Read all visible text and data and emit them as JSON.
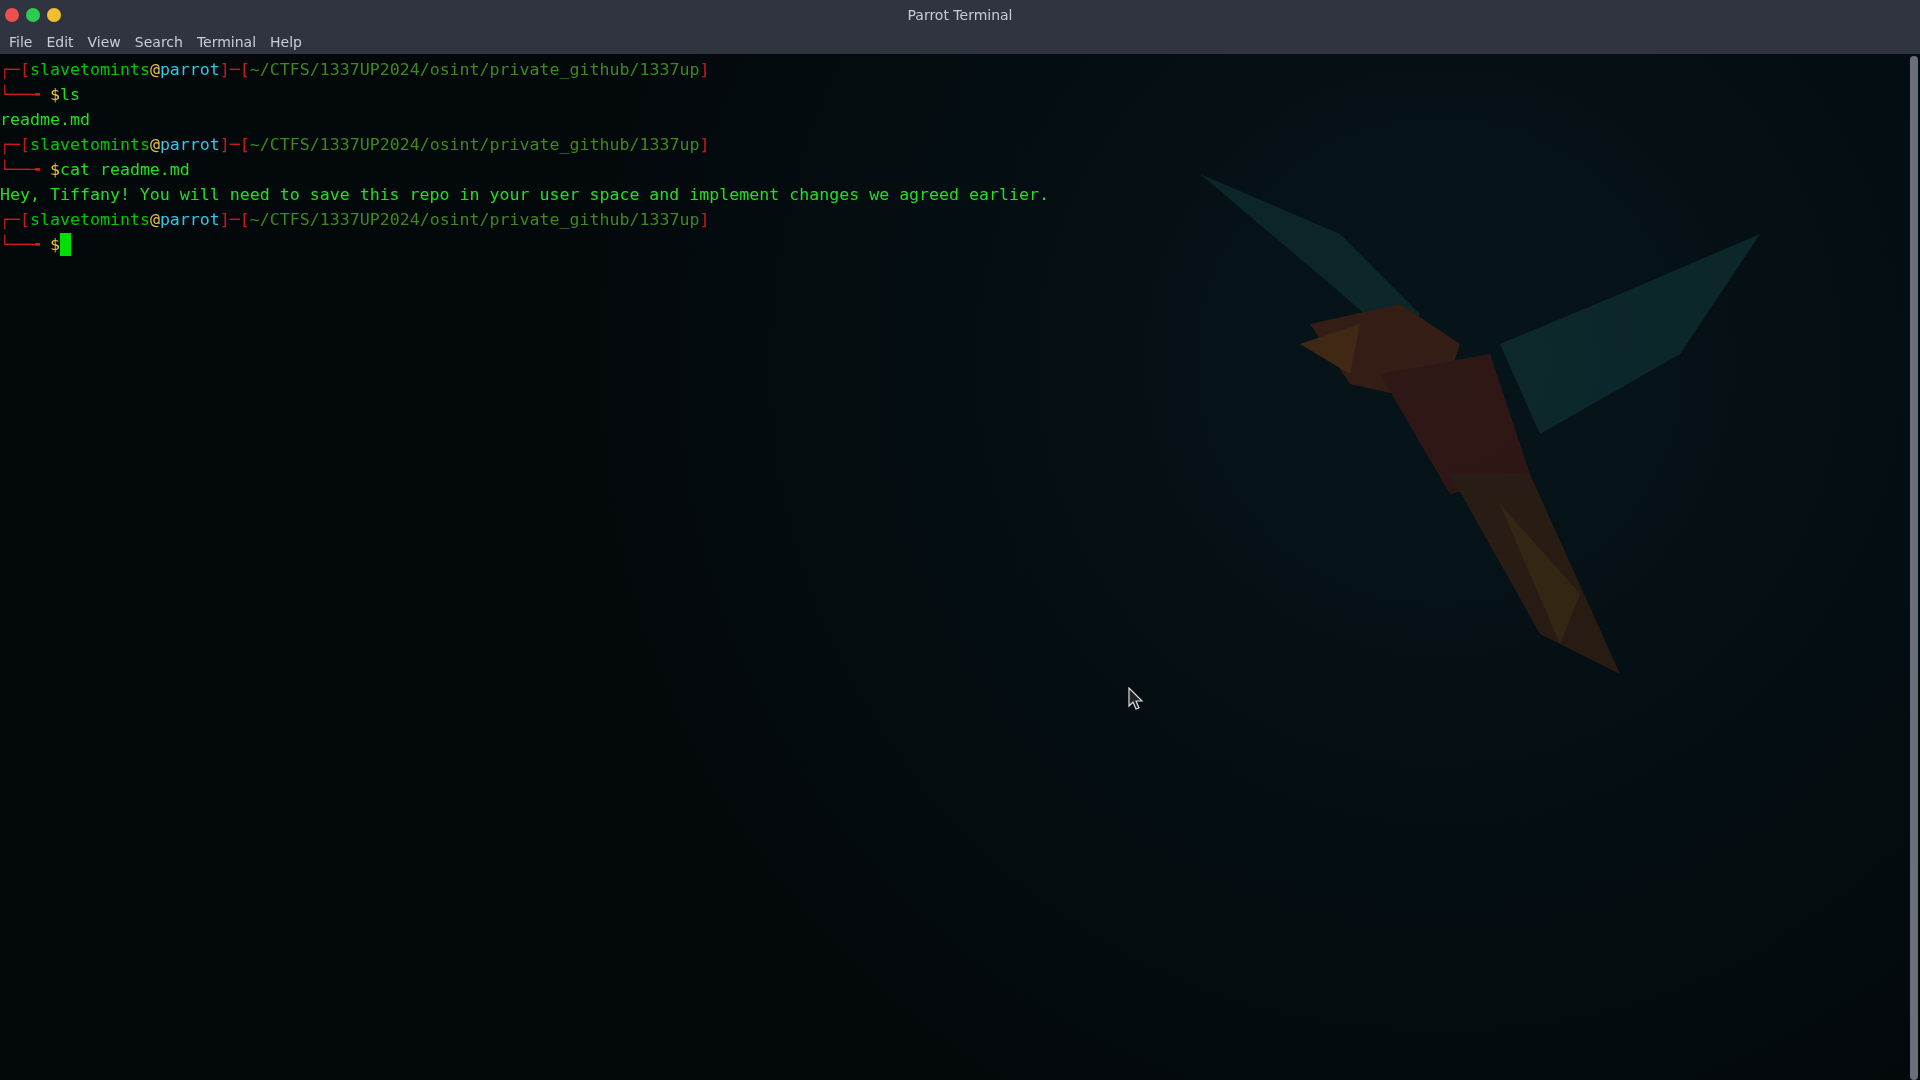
{
  "window": {
    "title": "Parrot Terminal",
    "controls": [
      {
        "color": "#ed4f4f"
      },
      {
        "color": "#2fcb4e"
      },
      {
        "color": "#f3bf30"
      }
    ]
  },
  "menu": [
    "File",
    "Edit",
    "View",
    "Search",
    "Terminal",
    "Help"
  ],
  "terminal": {
    "lines": [
      {
        "kind": "prompt",
        "top_open": "┌─[",
        "user": "slavetomints",
        "at": "@",
        "host": "parrot",
        "separator": "]─[",
        "path": "~/CTFS/1337UP2024/osint/private_github/1337up",
        "top_close": "]",
        "bottom": "└──╼ ",
        "sigil": "$",
        "command": "ls",
        "cursor": false
      },
      {
        "kind": "output",
        "text": "readme.md"
      },
      {
        "kind": "prompt",
        "top_open": "┌─[",
        "user": "slavetomints",
        "at": "@",
        "host": "parrot",
        "separator": "]─[",
        "path": "~/CTFS/1337UP2024/osint/private_github/1337up",
        "top_close": "]",
        "bottom": "└──╼ ",
        "sigil": "$",
        "command": "cat readme.md",
        "cursor": false
      },
      {
        "kind": "output",
        "text": "Hey, Tiffany! You will need to save this repo in your user space and implement changes we agreed earlier."
      },
      {
        "kind": "prompt",
        "top_open": "┌─[",
        "user": "slavetomints",
        "at": "@",
        "host": "parrot",
        "separator": "]─[",
        "path": "~/CTFS/1337UP2024/osint/private_github/1337up",
        "top_close": "]",
        "bottom": "└──╼ ",
        "sigil": "$",
        "cursor": true
      }
    ]
  }
}
